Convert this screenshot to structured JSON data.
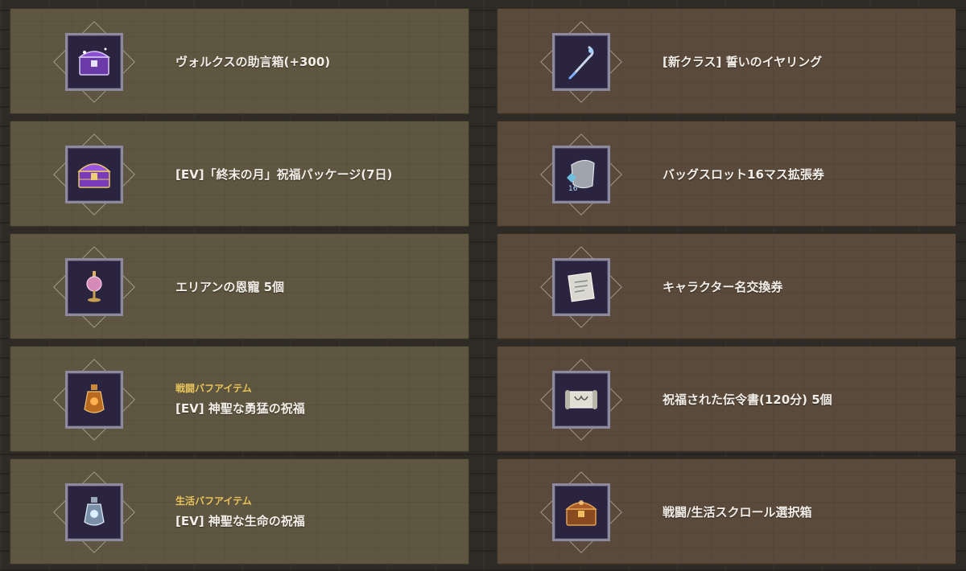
{
  "left": [
    {
      "category": "",
      "name": "ヴォルクスの助言箱(+300)",
      "icon": "purple-chest-icon"
    },
    {
      "category": "",
      "name": "[EV]「終末の月」祝福パッケージ(7日)",
      "icon": "purple-treasure-chest-icon"
    },
    {
      "category": "",
      "name": "エリアンの恩寵 5個",
      "icon": "pink-potion-icon"
    },
    {
      "category": "戦闘バフアイテム",
      "name": "[EV] 神聖な勇猛の祝福",
      "icon": "orange-potion-icon"
    },
    {
      "category": "生活バフアイテム",
      "name": "[EV] 神聖な生命の祝福",
      "icon": "blue-potion-icon"
    }
  ],
  "right": [
    {
      "category": "",
      "name": "[新クラス] 誓いのイヤリング",
      "icon": "earring-icon"
    },
    {
      "category": "",
      "name": "バッグスロット16マス拡張券",
      "icon": "bag-slot-icon"
    },
    {
      "category": "",
      "name": "キャラクター名交換券",
      "icon": "name-ticket-icon"
    },
    {
      "category": "",
      "name": "祝福された伝令書(120分) 5個",
      "icon": "scroll-icon"
    },
    {
      "category": "",
      "name": "戦闘/生活スクロール選択箱",
      "icon": "wooden-chest-icon"
    }
  ],
  "icons": {
    "bag_slot_badge": "16"
  }
}
